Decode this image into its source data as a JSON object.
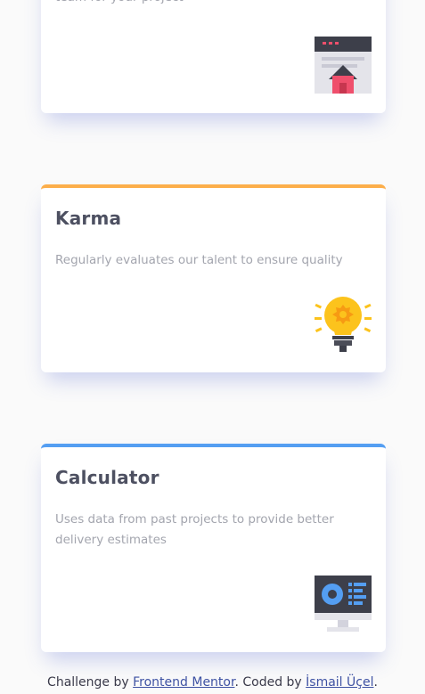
{
  "cards": [
    {
      "title": "",
      "description": "team for your project",
      "icon": "builder-window-icon",
      "accent": "#fcae4a"
    },
    {
      "title": "Karma",
      "description": "Regularly evaluates our talent to ensure quality",
      "icon": "lightbulb-icon",
      "accent": "#fcae4a"
    },
    {
      "title": "Calculator",
      "description": "Uses data from past projects to provide better delivery estimates",
      "icon": "monitor-calculator-icon",
      "accent": "#549ef2"
    }
  ],
  "attribution": {
    "prefix": "Challenge by ",
    "link1": "Frontend Mentor",
    "middle": ". Coded by ",
    "link2": "İsmail Üçel",
    "suffix": "."
  },
  "colors": {
    "background": "#fafafa",
    "title": "#4d5061",
    "description": "#a3a5ae",
    "orange_accent": "#fcae4a",
    "blue_accent": "#549ef2",
    "link": "#3e52a3"
  }
}
